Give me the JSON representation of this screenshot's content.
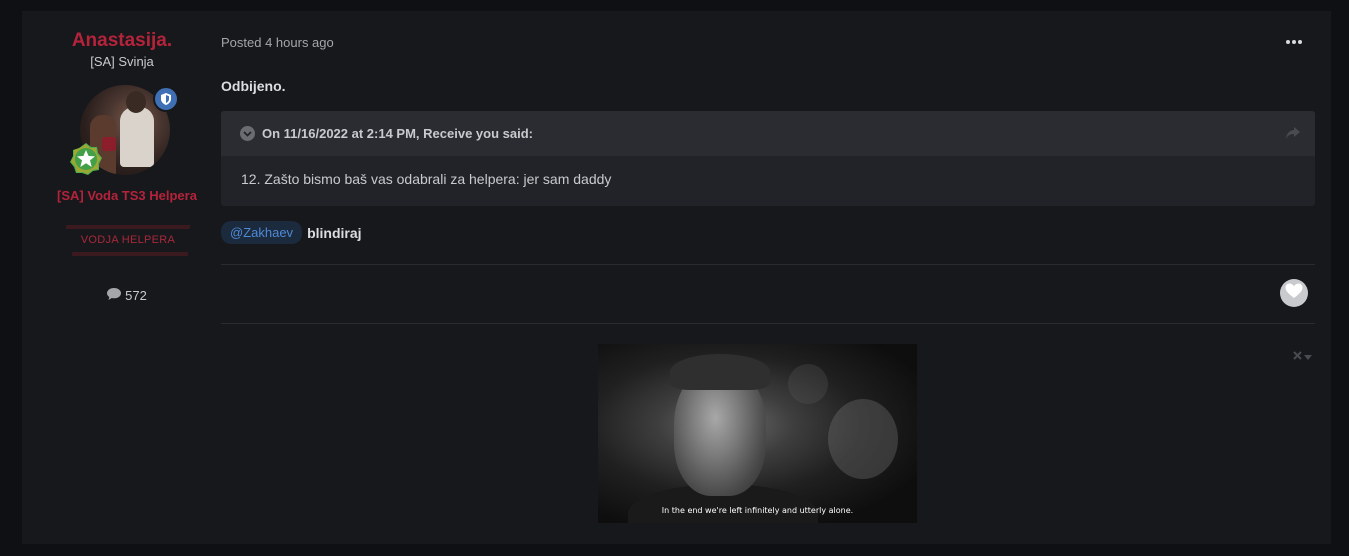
{
  "author": {
    "name": "Anastasija.",
    "title": "[SA] Svinja",
    "group": "[SA] Voda TS3 Helpera",
    "role_ribbon": "VODJA HELPERA",
    "post_count": "572"
  },
  "post": {
    "meta": "Posted 4 hours ago",
    "lead_text": "Odbijeno.",
    "quote": {
      "citation": "On 11/16/2022 at 2:14 PM, Receive you said:",
      "body": "12. Zašto bismo baš vas odabrali za helpera: jer sam daddy"
    },
    "mention": "@Zakhaev",
    "reply_text": "blindiraj"
  },
  "signature": {
    "gif_caption": "In the end we're left infinitely and utterly alone."
  },
  "icons": {
    "shield": "shield-icon",
    "rank": "star-badge-icon",
    "comment": "comment-bubble-icon",
    "more": "ellipsis-icon",
    "quote_toggle": "chevron-down-icon",
    "share": "share-arrow-icon",
    "like": "heart-icon",
    "signature_close": "close-icon"
  },
  "colors": {
    "brand_red": "#b5233b",
    "background": "#0f1013",
    "card": "#17181c",
    "mention_text": "#4d8ad6",
    "shield_blue": "#3f6fb4",
    "rank_green": "#4caf50"
  }
}
